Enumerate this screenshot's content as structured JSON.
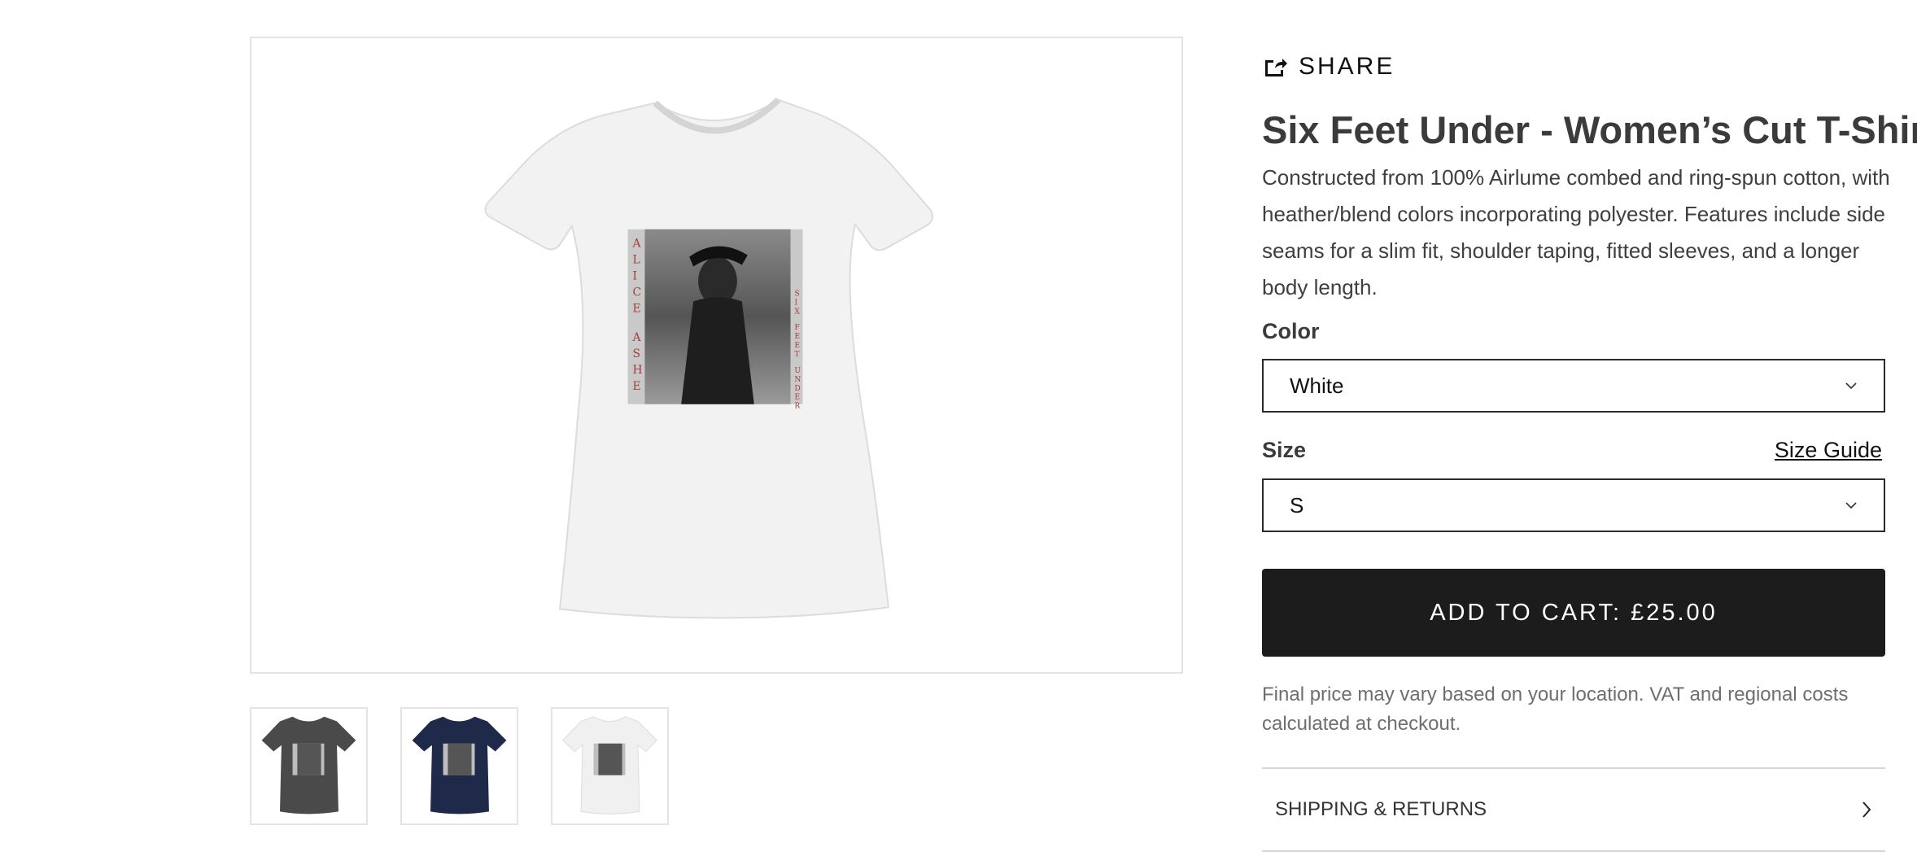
{
  "gallery": {
    "main_image": {
      "alt": "White women's cut t-shirt with Alice Ashe Six Feet Under print",
      "shirt_color": "#f2f2f2",
      "print_text_left": "ALICE ASHE",
      "print_text_right": "SIX FEET UNDER",
      "print_text_color": "#a83a3a"
    },
    "thumbnails": [
      {
        "name": "Dark Grey",
        "color": "#4a4a4a"
      },
      {
        "name": "Navy",
        "color": "#1f2a4a"
      },
      {
        "name": "White",
        "color": "#f0f0f0"
      }
    ]
  },
  "product": {
    "share_label": "SHARE",
    "title": "Six Feet Under - Women’s Cut T-Shirt",
    "description": "Constructed from 100% Airlume combed and ring-spun cotton, with heather/blend colors incorporating polyester. Features include side seams for a slim fit, shoulder taping, fitted sleeves, and a longer body length.",
    "color_label": "Color",
    "color_value": "White",
    "size_label": "Size",
    "size_guide_label": "Size Guide",
    "size_value": "S",
    "add_to_cart_label": "ADD TO CART: £25.00",
    "price_note": "Final price may vary based on your location. VAT and regional costs calculated at checkout.",
    "accordion_label": "SHIPPING & RETURNS"
  },
  "colors": {
    "button_bg": "#1c1c1c",
    "text_primary": "#3b3b3b",
    "text_muted": "#6e6e6e",
    "border": "#e4e4e4"
  },
  "icons": {
    "share": "share-icon",
    "select_chevron": "chevron-down-icon",
    "accordion_chevron": "chevron-right-icon"
  }
}
